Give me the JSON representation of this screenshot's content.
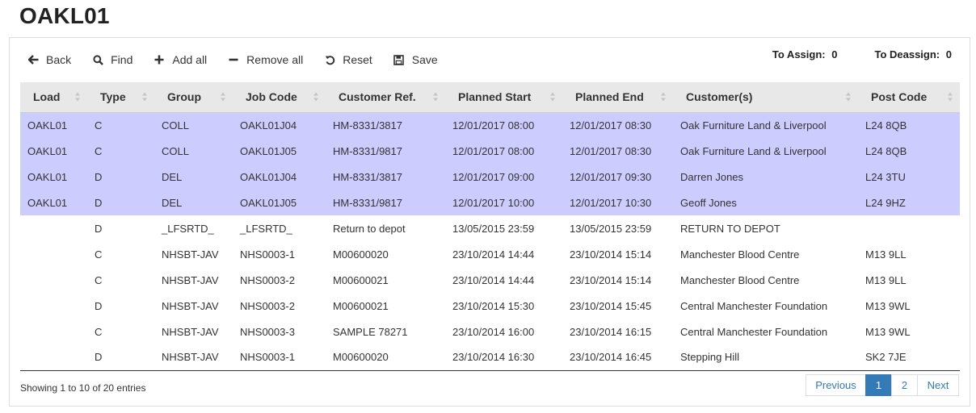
{
  "page": {
    "title": "OAKL01"
  },
  "toolbar": {
    "back": {
      "label": "Back",
      "icon": "arrow-left-icon"
    },
    "find": {
      "label": "Find",
      "icon": "search-icon"
    },
    "add_all": {
      "label": "Add all",
      "icon": "plus-icon"
    },
    "remove_all": {
      "label": "Remove all",
      "icon": "minus-icon"
    },
    "reset": {
      "label": "Reset",
      "icon": "undo-icon"
    },
    "save": {
      "label": "Save",
      "icon": "floppy-disk-icon"
    }
  },
  "counters": {
    "assign_label": "To Assign:",
    "assign_value": "0",
    "deassign_label": "To Deassign:",
    "deassign_value": "0"
  },
  "table": {
    "columns": [
      "Load",
      "Type",
      "Group",
      "Job Code",
      "Customer Ref.",
      "Planned Start",
      "Planned End",
      "Customer(s)",
      "Post Code"
    ],
    "selected_row_color": "#ccccff",
    "rows": [
      [
        "OAKL01",
        "C",
        "COLL",
        "OAKL01J04",
        "HM-8331/3817",
        "12/01/2017 08:00",
        "12/01/2017 08:30",
        "Oak Furniture Land & Liverpool",
        "L24 8QB"
      ],
      [
        "OAKL01",
        "C",
        "COLL",
        "OAKL01J05",
        "HM-8331/9817",
        "12/01/2017 08:00",
        "12/01/2017 08:30",
        "Oak Furniture Land & Liverpool",
        "L24 8QB"
      ],
      [
        "OAKL01",
        "D",
        "DEL",
        "OAKL01J04",
        "HM-8331/3817",
        "12/01/2017 09:00",
        "12/01/2017 09:30",
        "Darren Jones",
        "L24 3TU"
      ],
      [
        "OAKL01",
        "D",
        "DEL",
        "OAKL01J05",
        "HM-8331/9817",
        "12/01/2017 10:00",
        "12/01/2017 10:30",
        "Geoff Jones",
        "L24 9HZ"
      ],
      [
        "",
        "D",
        "_LFSRTD_",
        "_LFSRTD_",
        "Return to depot",
        "13/05/2015 23:59",
        "13/05/2015 23:59",
        "RETURN TO DEPOT",
        ""
      ],
      [
        "",
        "C",
        "NHSBT-JAV",
        "NHS0003-1",
        "M00600020",
        "23/10/2014 14:44",
        "23/10/2014 15:14",
        "Manchester Blood Centre",
        "M13 9LL"
      ],
      [
        "",
        "C",
        "NHSBT-JAV",
        "NHS0003-2",
        "M00600021",
        "23/10/2014 14:44",
        "23/10/2014 15:14",
        "Manchester Blood Centre",
        "M13 9LL"
      ],
      [
        "",
        "D",
        "NHSBT-JAV",
        "NHS0003-2",
        "M00600021",
        "23/10/2014 15:30",
        "23/10/2014 15:45",
        "Central Manchester Foundation",
        "M13 9WL"
      ],
      [
        "",
        "C",
        "NHSBT-JAV",
        "NHS0003-3",
        "SAMPLE 78271",
        "23/10/2014 16:00",
        "23/10/2014 16:15",
        "Central Manchester Foundation",
        "M13 9WL"
      ],
      [
        "",
        "D",
        "NHSBT-JAV",
        "NHS0003-1",
        "M00600020",
        "23/10/2014 16:30",
        "23/10/2014 16:45",
        "Stepping Hill",
        "SK2 7JE"
      ]
    ],
    "selected_rows": [
      0,
      1,
      2,
      3
    ]
  },
  "footer": {
    "info": "Showing 1 to 10 of 20 entries"
  },
  "pagination": {
    "previous": "Previous",
    "pages": [
      "1",
      "2"
    ],
    "current": "1",
    "next": "Next",
    "accent": "#337ab7"
  }
}
